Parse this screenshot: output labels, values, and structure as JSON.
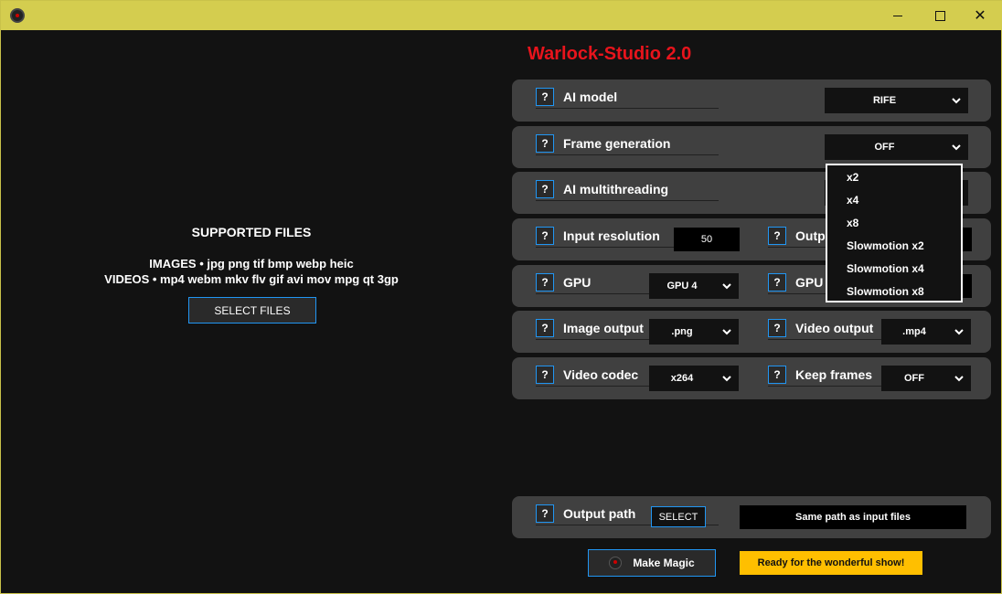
{
  "window": {
    "title_bar_color": "#d4cd4f",
    "icon": "warlock-logo-icon",
    "controls": {
      "minimize": "minimize-icon",
      "maximize": "maximize-icon",
      "close": "✕"
    }
  },
  "left_panel": {
    "heading": "SUPPORTED FILES",
    "images_line": "IMAGES • jpg png tif bmp webp heic",
    "videos_line": "VIDEOS • mp4 webm mkv flv gif avi mov mpg qt 3gp",
    "select_button": "SELECT FILES"
  },
  "app_title": "Warlock-Studio 2.0",
  "help_label": "?",
  "rows": {
    "ai_model": {
      "label": "AI model",
      "value": "RIFE"
    },
    "frame_generation": {
      "label": "Frame generation",
      "value": "OFF"
    },
    "ai_multithreading": {
      "label": "AI multithreading"
    },
    "input_resolution": {
      "label": "Input resolution",
      "value": "50",
      "right_label": "Outp"
    },
    "gpu": {
      "label": "GPU",
      "value": "GPU 4",
      "right_label": "GPU V"
    },
    "image_output": {
      "label": "Image output",
      "value": ".png",
      "right_label": "Video output",
      "right_value": ".mp4"
    },
    "video_codec": {
      "label": "Video codec",
      "value": "x264",
      "right_label": "Keep frames",
      "right_value": "OFF"
    },
    "output_path": {
      "label": "Output path",
      "select": "SELECT",
      "value": "Same path as input files"
    }
  },
  "frame_gen_menu": [
    "x2",
    "x4",
    "x8",
    "Slowmotion x2",
    "Slowmotion x4",
    "Slowmotion x8"
  ],
  "footer": {
    "magic_button": "Make Magic",
    "status": "Ready for the wonderful show!"
  },
  "colors": {
    "accent_blue": "#2196f3",
    "title_red": "#e8141c",
    "status_yellow": "#ffbf00",
    "card_bg": "#404040",
    "app_bg": "#121212"
  }
}
